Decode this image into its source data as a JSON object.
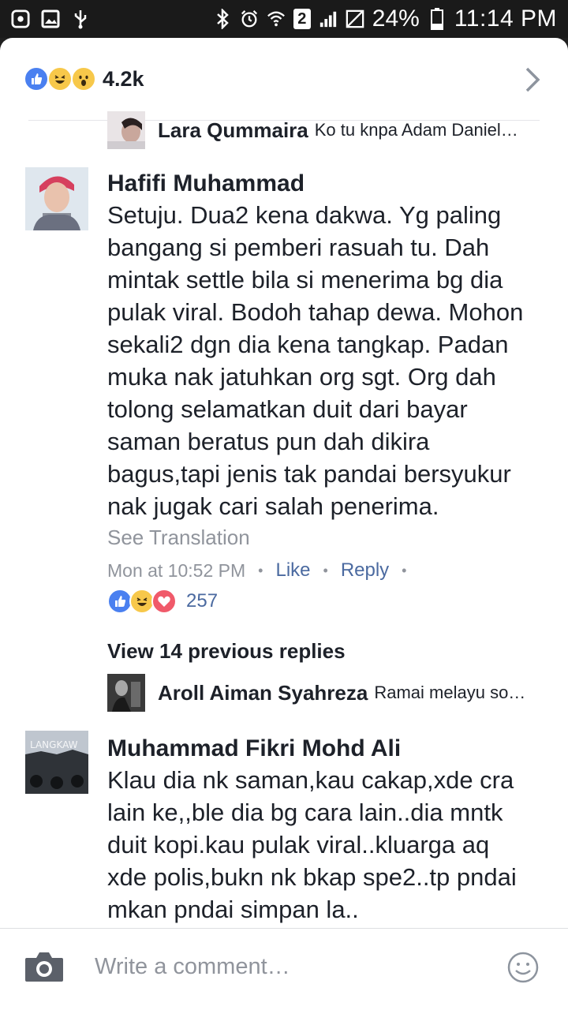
{
  "status_bar": {
    "battery": "24%",
    "time": "11:14 PM",
    "sim_badge": "2",
    "icons": [
      "screenshot-icon",
      "gallery-icon",
      "usb-icon",
      "bluetooth-icon",
      "alarm-icon",
      "wifi-icon",
      "signal-icon",
      "no-sim-icon",
      "battery-icon"
    ]
  },
  "reactions_header": {
    "count": "4.2k",
    "emojis": [
      "like",
      "haha",
      "wow"
    ]
  },
  "reply_top": {
    "author": "Lara Qummaira",
    "snippet": "Ko tu knpa Adam Daniel…"
  },
  "comment1": {
    "author": "Hafifi Muhammad",
    "lines": [
      "Setuju. Dua2 kena dakwa. Yg paling",
      "bangang si pemberi rasuah tu. Dah",
      "mintak settle bila si menerima bg dia",
      "pulak viral. Bodoh tahap dewa. Mohon",
      "sekali2 dgn dia kena tangkap. Padan",
      "muka nak jatuhkan org sgt. Org dah",
      "tolong selamatkan duit dari bayar",
      "saman beratus pun dah dikira",
      "bagus,tapi jenis tak pandai bersyukur",
      "nak jugak cari salah penerima."
    ],
    "see_translation": "See Translation",
    "time": "Mon at 10:52 PM",
    "like_label": "Like",
    "reply_label": "Reply",
    "reaction_count": "257",
    "reactions": [
      "like",
      "haha",
      "love"
    ]
  },
  "view_previous": "View 14 previous replies",
  "reply_bottom": {
    "author": "Aroll Aiman Syahreza",
    "snippet": "Ramai melayu so…"
  },
  "comment2": {
    "author": "Muhammad Fikri Mohd Ali",
    "lines": [
      "Klau dia nk saman,kau cakap,xde cra",
      "lain ke,,ble dia bg cara lain..dia mntk",
      "duit kopi.kau pulak viral..kluarga aq",
      "xde polis,bukn nk bkap spe2..tp pndai",
      "mkan pndai simpan la.."
    ],
    "avatar_text": "LANGKAW"
  },
  "composer": {
    "placeholder": "Write a comment…"
  },
  "colors": {
    "like_blue": "#4a80f0",
    "haha_yellow": "#f7c84a",
    "love_red": "#f05a6a",
    "link_blue": "#4b6aa0",
    "muted_gray": "#90949c"
  }
}
